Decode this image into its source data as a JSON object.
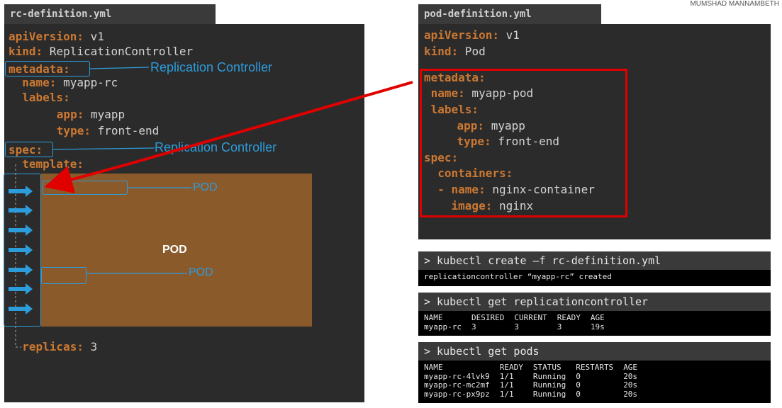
{
  "author": "MUMSHAD MANNAMBETH",
  "rc_file": {
    "filename": "rc-definition.yml",
    "lines": [
      {
        "key": "apiVersion:",
        "value": " v1"
      },
      {
        "key": "kind:",
        "value": " ReplicationController"
      },
      {
        "key": "metadata:",
        "value": ""
      },
      {
        "key": "  name:",
        "value": " myapp-rc"
      },
      {
        "key": "  labels:",
        "value": ""
      },
      {
        "key": "      app:",
        "value": " myapp"
      },
      {
        "key": "      type:",
        "value": " front-end"
      },
      {
        "key": "spec:",
        "value": ""
      },
      {
        "key": "  template:",
        "value": ""
      },
      {
        "key": "  replicas:",
        "value": " 3"
      }
    ],
    "annotations": {
      "metadata": "Replication Controller",
      "spec": "Replication Controller",
      "pod_top": "POD",
      "pod_mid": "POD",
      "pod_center": "POD"
    }
  },
  "pod_file": {
    "filename": "pod-definition.yml",
    "lines": [
      {
        "key": "apiVersion:",
        "value": " v1"
      },
      {
        "key": "kind:",
        "value": " Pod"
      },
      {
        "key": "metadata:",
        "value": ""
      },
      {
        "key": " name:",
        "value": " myapp-pod"
      },
      {
        "key": " labels:",
        "value": ""
      },
      {
        "key": "    app:",
        "value": " myapp"
      },
      {
        "key": "    type:",
        "value": " front-end"
      },
      {
        "key": "spec:",
        "value": ""
      },
      {
        "key": "  containers:",
        "value": ""
      },
      {
        "key": "  - name:",
        "value": " nginx-container"
      },
      {
        "key": "    image:",
        "value": " nginx"
      }
    ]
  },
  "terminals": [
    {
      "command": "> kubectl create –f rc-definition.yml",
      "rows": [
        [
          "replicationcontroller “myapp-rc” created"
        ]
      ]
    },
    {
      "command": "> kubectl get replicationcontroller",
      "rows": [
        [
          "NAME",
          "DESIRED",
          "CURRENT",
          "READY",
          "AGE"
        ],
        [
          "myapp-rc",
          "3",
          "3",
          "3",
          "19s"
        ]
      ]
    },
    {
      "command": "> kubectl get pods",
      "rows": [
        [
          "NAME",
          "READY",
          "STATUS",
          "RESTARTS",
          "AGE"
        ],
        [
          "myapp-rc-4lvk9",
          "1/1",
          "Running",
          "0",
          "20s"
        ],
        [
          "myapp-rc-mc2mf",
          "1/1",
          "Running",
          "0",
          "20s"
        ],
        [
          "myapp-rc-px9pz",
          "1/1",
          "Running",
          "0",
          "20s"
        ]
      ]
    }
  ],
  "colors": {
    "key": "#cc7832",
    "annotation": "#2d9cdb",
    "pod_block": "#8b5a2b",
    "highlight": "#e00000"
  }
}
